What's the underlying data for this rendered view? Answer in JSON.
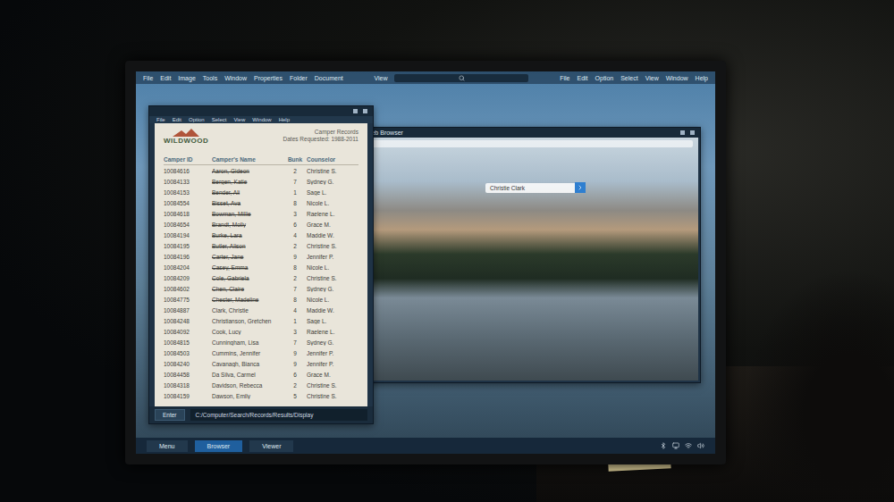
{
  "menubar": {
    "left": [
      "File",
      "Edit",
      "Image",
      "Tools",
      "Window",
      "Properties",
      "Folder",
      "Document"
    ],
    "center": "View",
    "right": [
      "File",
      "Edit",
      "Option",
      "Select",
      "View",
      "Window",
      "Help"
    ]
  },
  "viewer": {
    "menu": [
      "File",
      "Edit",
      "Option",
      "Select",
      "View",
      "Window",
      "Help"
    ],
    "document": {
      "logo": "WILDWOOD",
      "title": "Camper Records",
      "subtitle": "Dates Requested: 1988-2011",
      "columns": [
        "Camper ID",
        "Camper's Name",
        "Bunk",
        "Counselor"
      ],
      "rows": [
        {
          "id": "10084616",
          "name": "Aaron, Gideon",
          "bunk": "2",
          "counselor": "Christine S.",
          "struck": true
        },
        {
          "id": "10084133",
          "name": "Bergen, Katie",
          "bunk": "7",
          "counselor": "Sydney G.",
          "struck": true
        },
        {
          "id": "10084153",
          "name": "Bender, Ali",
          "bunk": "1",
          "counselor": "Sage L.",
          "struck": true
        },
        {
          "id": "10084554",
          "name": "Bisset, Ava",
          "bunk": "8",
          "counselor": "Nicole L.",
          "struck": true
        },
        {
          "id": "10084618",
          "name": "Bowman, Millie",
          "bunk": "3",
          "counselor": "Raelene L.",
          "struck": true
        },
        {
          "id": "10084654",
          "name": "Brandt, Molly",
          "bunk": "6",
          "counselor": "Grace M.",
          "struck": true
        },
        {
          "id": "10084194",
          "name": "Burke, Lara",
          "bunk": "4",
          "counselor": "Maddie W.",
          "struck": true
        },
        {
          "id": "10084195",
          "name": "Butler, Alison",
          "bunk": "2",
          "counselor": "Christine S.",
          "struck": true
        },
        {
          "id": "10084196",
          "name": "Carter, Jane",
          "bunk": "9",
          "counselor": "Jennifer P.",
          "struck": true
        },
        {
          "id": "10084204",
          "name": "Casey, Emma",
          "bunk": "8",
          "counselor": "Nicole L.",
          "struck": true
        },
        {
          "id": "10084209",
          "name": "Cole, Gabriela",
          "bunk": "2",
          "counselor": "Christine S.",
          "struck": true
        },
        {
          "id": "10084602",
          "name": "Chen, Claire",
          "bunk": "7",
          "counselor": "Sydney G.",
          "struck": true
        },
        {
          "id": "10084775",
          "name": "Chester, Madeline",
          "bunk": "8",
          "counselor": "Nicole L.",
          "struck": true
        },
        {
          "id": "10084887",
          "name": "Clark, Christie",
          "bunk": "4",
          "counselor": "Maddie W.",
          "struck": false
        },
        {
          "id": "10084248",
          "name": "Christianson, Gretchen",
          "bunk": "1",
          "counselor": "Sage L.",
          "struck": false
        },
        {
          "id": "10084092",
          "name": "Cook, Lucy",
          "bunk": "3",
          "counselor": "Raelene L.",
          "struck": false
        },
        {
          "id": "10084815",
          "name": "Cunningham, Lisa",
          "bunk": "7",
          "counselor": "Sydney G.",
          "struck": false
        },
        {
          "id": "10084503",
          "name": "Cummins, Jennifer",
          "bunk": "9",
          "counselor": "Jennifer P.",
          "struck": false
        },
        {
          "id": "10084240",
          "name": "Cavanagh, Bianca",
          "bunk": "9",
          "counselor": "Jennifer P.",
          "struck": false
        },
        {
          "id": "10084458",
          "name": "Da Silva, Carmel",
          "bunk": "6",
          "counselor": "Grace M.",
          "struck": false
        },
        {
          "id": "10084318",
          "name": "Davidson, Rebecca",
          "bunk": "2",
          "counselor": "Christine S.",
          "struck": false
        },
        {
          "id": "10084159",
          "name": "Dawson, Emily",
          "bunk": "5",
          "counselor": "Christine S.",
          "struck": false
        }
      ]
    },
    "enter_button": "Enter",
    "path": "C:/Computer/Search/Records/Results/Display"
  },
  "browser": {
    "title": "Web Browser",
    "search": {
      "value": "Christie Clark"
    }
  },
  "taskbar": [
    {
      "label": "Menu",
      "selected": false
    },
    {
      "label": "Browser",
      "selected": true
    },
    {
      "label": "Viewer",
      "selected": false
    }
  ]
}
